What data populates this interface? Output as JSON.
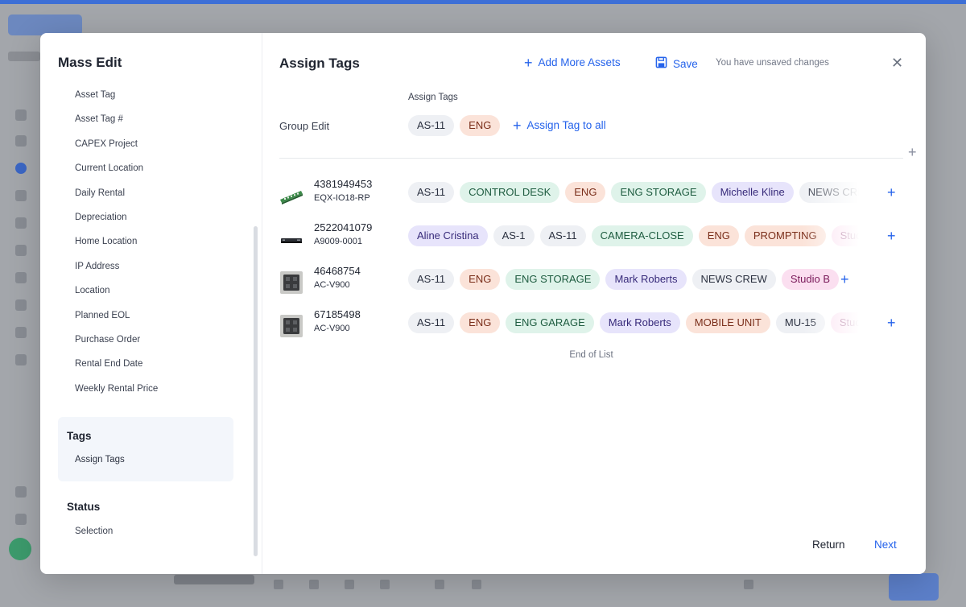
{
  "colors": {
    "accent": "#2563eb",
    "tag_grey": "#eef0f4",
    "tag_orange": "#fbe3d9",
    "tag_green": "#dff3ea",
    "tag_purple": "#e7e4fb",
    "tag_pink": "#fbdff0"
  },
  "left": {
    "title": "Mass Edit",
    "fields": [
      "Asset Tag",
      "Asset Tag #",
      "CAPEX Project",
      "Current Location",
      "Daily Rental",
      "Depreciation",
      "Home Location",
      "IP Address",
      "Location",
      "Planned EOL",
      "Purchase Order",
      "Rental End Date",
      "Weekly Rental Price"
    ],
    "tags_section": {
      "title": "Tags",
      "item": "Assign Tags"
    },
    "status_section": {
      "title": "Status",
      "item": "Selection"
    }
  },
  "header": {
    "title": "Assign Tags",
    "add_more_assets": "Add More Assets",
    "save": "Save",
    "unsaved": "You have unsaved changes",
    "close_icon": "close-icon"
  },
  "group": {
    "small_label": "Assign Tags",
    "label": "Group Edit",
    "tags": [
      {
        "text": "AS-11",
        "color": "grey"
      },
      {
        "text": "ENG",
        "color": "orange"
      }
    ],
    "assign_all": "Assign Tag to all"
  },
  "assets": [
    {
      "number": "4381949453",
      "model": "EQX-IO18-RP",
      "thumb": "patch-panel",
      "tags": [
        {
          "text": "AS-11",
          "color": "grey"
        },
        {
          "text": "CONTROL DESK",
          "color": "green"
        },
        {
          "text": "ENG",
          "color": "orange"
        },
        {
          "text": "ENG STORAGE",
          "color": "green"
        },
        {
          "text": "Michelle Kline",
          "color": "purple"
        },
        {
          "text": "NEWS CREW",
          "color": "grey"
        }
      ]
    },
    {
      "number": "2522041079",
      "model": "A9009-0001",
      "thumb": "rack-unit",
      "tags": [
        {
          "text": "Aline Cristina",
          "color": "purple"
        },
        {
          "text": "AS-1",
          "color": "grey"
        },
        {
          "text": "AS-11",
          "color": "grey"
        },
        {
          "text": "CAMERA-CLOSE",
          "color": "green"
        },
        {
          "text": "ENG",
          "color": "orange"
        },
        {
          "text": "PROMPTING",
          "color": "orange"
        },
        {
          "text": "Studio",
          "color": "pink"
        }
      ]
    },
    {
      "number": "46468754",
      "model": "AC-V900",
      "thumb": "wall-plate",
      "tags": [
        {
          "text": "AS-11",
          "color": "grey"
        },
        {
          "text": "ENG",
          "color": "orange"
        },
        {
          "text": "ENG STORAGE",
          "color": "green"
        },
        {
          "text": "Mark Roberts",
          "color": "purple"
        },
        {
          "text": "NEWS CREW",
          "color": "grey"
        },
        {
          "text": "Studio B",
          "color": "pink"
        }
      ]
    },
    {
      "number": "67185498",
      "model": "AC-V900",
      "thumb": "wall-plate",
      "tags": [
        {
          "text": "AS-11",
          "color": "grey"
        },
        {
          "text": "ENG",
          "color": "orange"
        },
        {
          "text": "ENG GARAGE",
          "color": "green"
        },
        {
          "text": "Mark Roberts",
          "color": "purple"
        },
        {
          "text": "MOBILE UNIT",
          "color": "orange"
        },
        {
          "text": "MU-15",
          "color": "grey"
        },
        {
          "text": "Studio",
          "color": "pink"
        }
      ]
    }
  ],
  "end_of_list": "End of List",
  "footer": {
    "return": "Return",
    "next": "Next"
  }
}
